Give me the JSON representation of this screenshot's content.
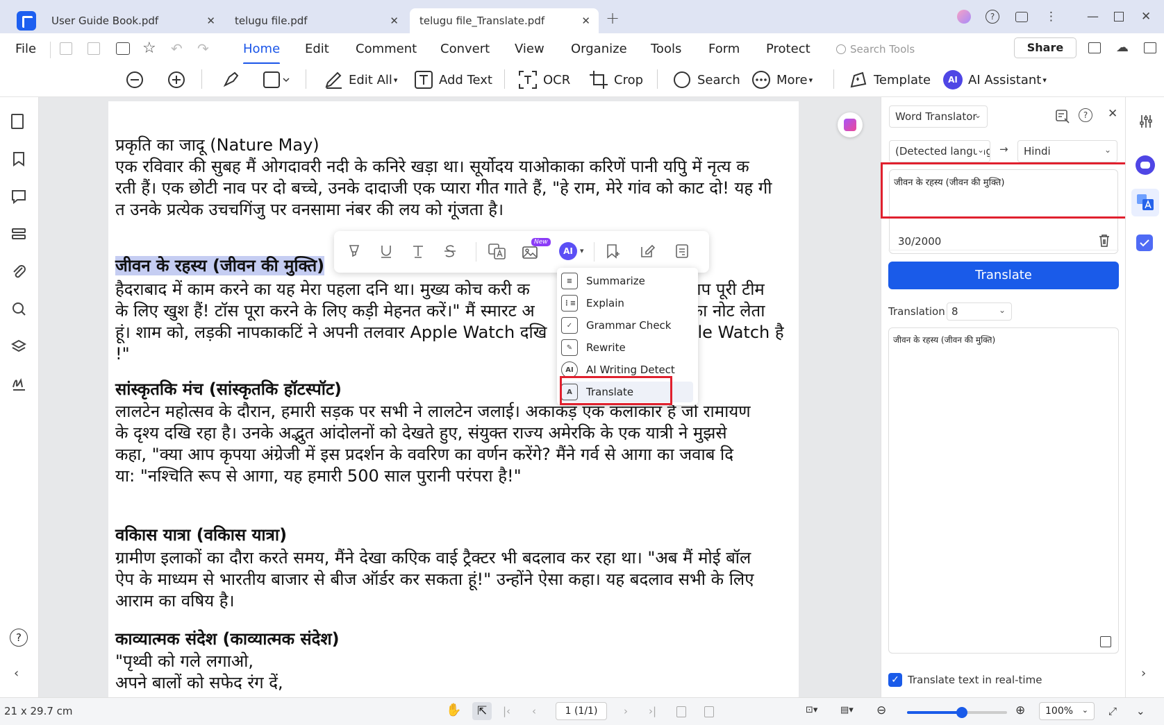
{
  "tabs": [
    {
      "label": "User Guide Book.pdf"
    },
    {
      "label": "telugu file.pdf"
    },
    {
      "label": "telugu file_Translate.pdf"
    }
  ],
  "menu": {
    "file": "File",
    "items": [
      "Home",
      "Edit",
      "Comment",
      "Convert",
      "View",
      "Organize",
      "Tools",
      "Form",
      "Protect"
    ],
    "search_placeholder": "Search Tools",
    "share": "Share"
  },
  "toolbar": {
    "edit_all": "Edit All",
    "add_text": "Add Text",
    "ocr": "OCR",
    "crop": "Crop",
    "search": "Search",
    "more": "More",
    "template": "Template",
    "ai_assistant": "AI Assistant"
  },
  "document": {
    "lines": [
      "प्रकृति का जादू (Nature May)",
      "एक रविवार की सुबह मैं ओगदावरी नदी के कनिरे खड़ा था। सूर्योदय याओकाका करिणें पानी यपिु में नृत्य क",
      "रती हैं। एक छोटी नाव पर दो बच्चे, उनके दादाजी एक प्यारा गीत गाते हैं, \"हे राम, मेरे गांव को काट दो! यह गी",
      "त उनके प्रत्येक उचचगिंजु पर वनसामा नंबर की लय को गूंजता है।",
      "जीवन के रहस्य (जीवन की मुक्ति)",
      "हैदराबाद में काम करने का यह मेरा पहला दनि था। मुख्य कोच करी क",
      "\"आप पूरी टीम",
      "के लिए खुश हैं! टॉस पूरा करने के लिए कड़ी मेहनत करें।\" मैं स्मारट अ",
      "टे का नोट लेता",
      "हूं। शाम को, लड़की नापकाकटिं ने अपनी तलवार Apple Watch दखि",
      "pple Watch है",
      "!\"",
      "सांस्कृतकि मंच (सांस्कृतकि हॉटस्पॉट)",
      "लालटेन महोत्सव के दौरान, हमारी सड़क पर सभी ने लालटेन जलाई। अकाकड़ एक कलाकार है जो रामायण",
      "के दृश्य दखि रहा है। उनके अद्भुत आंदोलनों को देखते हुए, संयुक्त राज्य अमेरकि के एक यात्री ने मुझसे",
      "कहा, \"क्या आप कृपया अंग्रेजी में इस प्रदर्शन के ववरिण का वर्णन करेंगे? मैंने गर्व से आगा का जवाब दि",
      "या: \"नश्चिति रूप से आगा, यह हमारी 500 साल पुरानी परंपरा है!\"",
      "वकिास यात्रा (वकिास यात्रा)",
      "ग्रामीण इलाकों का दौरा करते समय, मैंने देखा कएिक वाई ट्रैक्टर भी बदलाव कर रहा था। \"अब मैं मोई बॉल",
      "ऐप के माध्यम से भारतीय बाजार से बीज ऑर्डर कर सकता हूं!\" उन्होंने ऐसा कहा। यह बदलाव सभी के लिए",
      "आराम का वषिय है।",
      "काव्यात्मक संदेश (काव्यात्मक संदेश)",
      "\"पृथ्वी को गले लगाओ,",
      "अपने बालों को सफेद रंग दें,"
    ]
  },
  "float_toolbar": {
    "new_badge": "New",
    "ai_label": "AI"
  },
  "ai_menu": {
    "items": [
      "Summarize",
      "Explain",
      "Grammar Check",
      "Rewrite",
      "AI Writing Detect",
      "Translate"
    ]
  },
  "translator": {
    "mode": "Word Translator",
    "source_lang": "(Detected language)",
    "arrow": "→",
    "target_lang": "Hindi",
    "input_text": "जीवन के रहस्य (जीवन की मुक्ति)",
    "char_count": "30/2000",
    "translate_button": "Translate",
    "translation_label": "Translation",
    "font_size": "8",
    "output_text": "जीवन के रहस्य (जीवन की मुक्ति)",
    "realtime_label": "Translate text in real-time"
  },
  "status": {
    "page_size": "21 x 29.7 cm",
    "page_indicator": "1 (1/1)",
    "zoom": "100%",
    "zoom_slider_fraction": 0.55
  },
  "colors": {
    "accent": "#1a5be9",
    "highlight_red": "#e0202e"
  }
}
